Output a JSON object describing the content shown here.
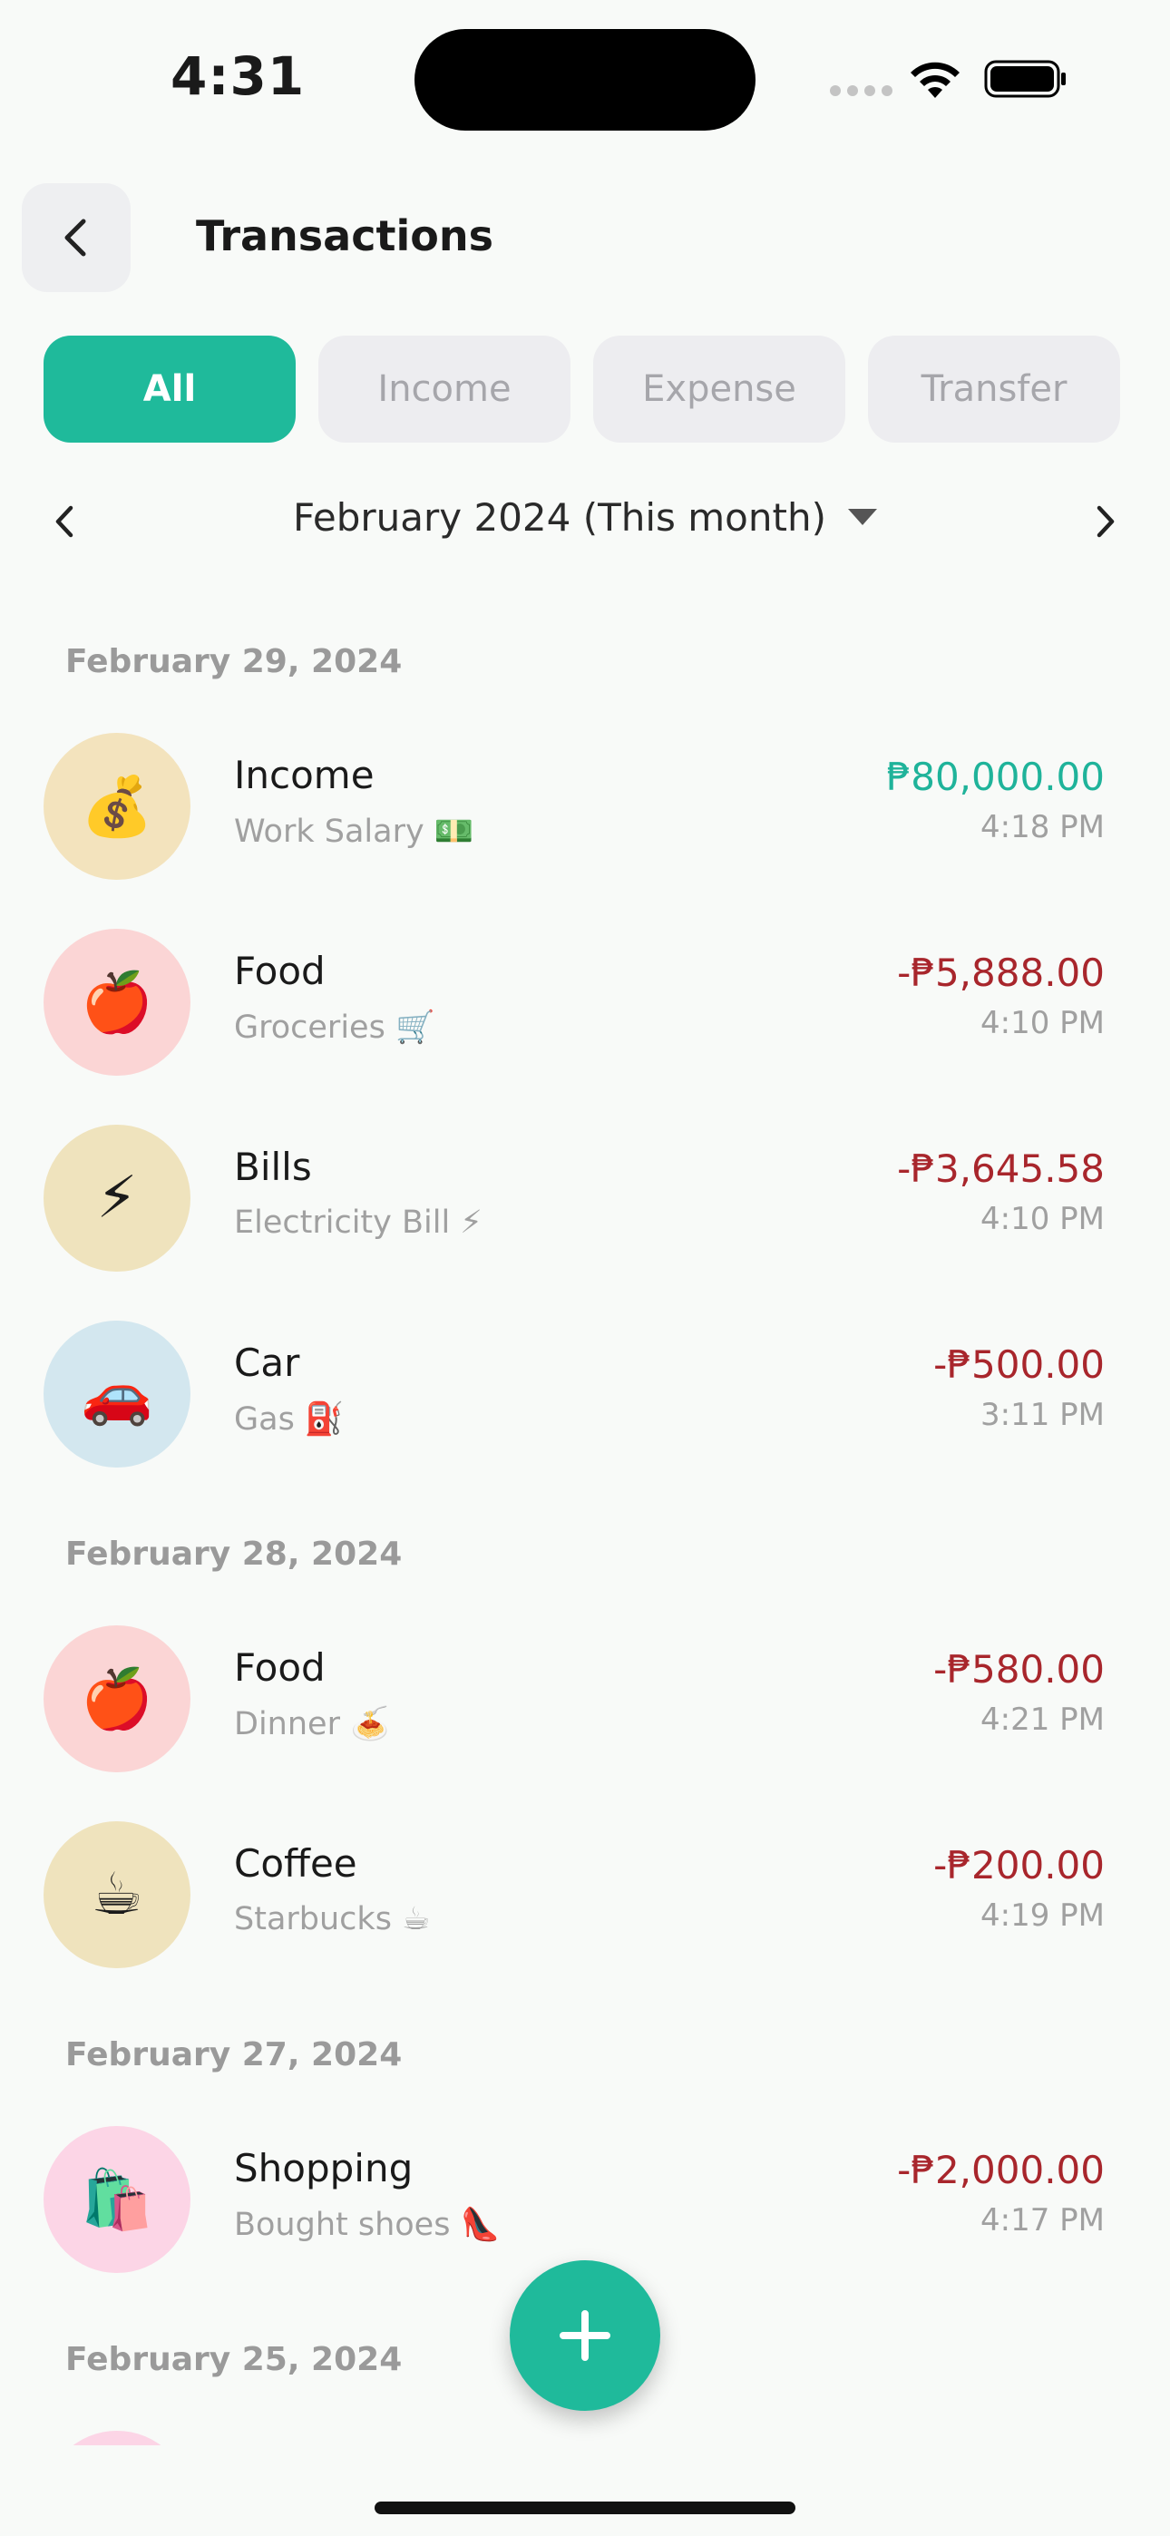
{
  "status_bar": {
    "time": "4:31"
  },
  "header": {
    "title": "Transactions"
  },
  "tabs": [
    {
      "label": "All",
      "active": true
    },
    {
      "label": "Income",
      "active": false
    },
    {
      "label": "Expense",
      "active": false
    },
    {
      "label": "Transfer",
      "active": false
    }
  ],
  "month_nav": {
    "label": "February 2024 (This month)"
  },
  "colors": {
    "accent": "#1fba9b",
    "income": "#1fb39a",
    "expense": "#a8262c"
  },
  "groups": [
    {
      "date": "February 29, 2024",
      "items": [
        {
          "icon": "money-bag-icon",
          "emoji": "💰",
          "bg": "#f3e3bd",
          "category": "Income",
          "note": "Work Salary 💵",
          "amount": "₱80,000.00",
          "type": "income",
          "time": "4:18 PM"
        },
        {
          "icon": "apple-icon",
          "emoji": "🍎",
          "bg": "#fbd5d5",
          "category": "Food",
          "note": "Groceries 🛒",
          "amount": "-₱5,888.00",
          "type": "expense",
          "time": "4:10 PM"
        },
        {
          "icon": "lightning-icon",
          "emoji": "⚡",
          "bg": "#efe3bd",
          "category": "Bills",
          "note": "Electricity Bill ⚡",
          "amount": "-₱3,645.58",
          "type": "expense",
          "time": "4:10 PM"
        },
        {
          "icon": "car-icon",
          "emoji": "🚗",
          "bg": "#d3e7ef",
          "category": "Car",
          "note": "Gas ⛽",
          "amount": "-₱500.00",
          "type": "expense",
          "time": "3:11 PM"
        }
      ]
    },
    {
      "date": "February 28, 2024",
      "items": [
        {
          "icon": "apple-icon",
          "emoji": "🍎",
          "bg": "#fbd5d5",
          "category": "Food",
          "note": "Dinner 🍝",
          "amount": "-₱580.00",
          "type": "expense",
          "time": "4:21 PM"
        },
        {
          "icon": "coffee-icon",
          "emoji": "☕",
          "bg": "#efe3bd",
          "category": "Coffee",
          "note": "Starbucks ☕",
          "amount": "-₱200.00",
          "type": "expense",
          "time": "4:19 PM"
        }
      ]
    },
    {
      "date": "February 27, 2024",
      "items": [
        {
          "icon": "shopping-bags-icon",
          "emoji": "🛍️",
          "bg": "#fcd5e6",
          "category": "Shopping",
          "note": "Bought shoes 👠",
          "amount": "-₱2,000.00",
          "type": "expense",
          "time": "4:17 PM"
        }
      ]
    },
    {
      "date": "February 25, 2024",
      "items": [
        {
          "icon": "category-icon",
          "emoji": "",
          "bg": "#fcd5e6",
          "category": "",
          "note": "",
          "amount": "",
          "type": "expense",
          "time": ""
        }
      ]
    }
  ]
}
